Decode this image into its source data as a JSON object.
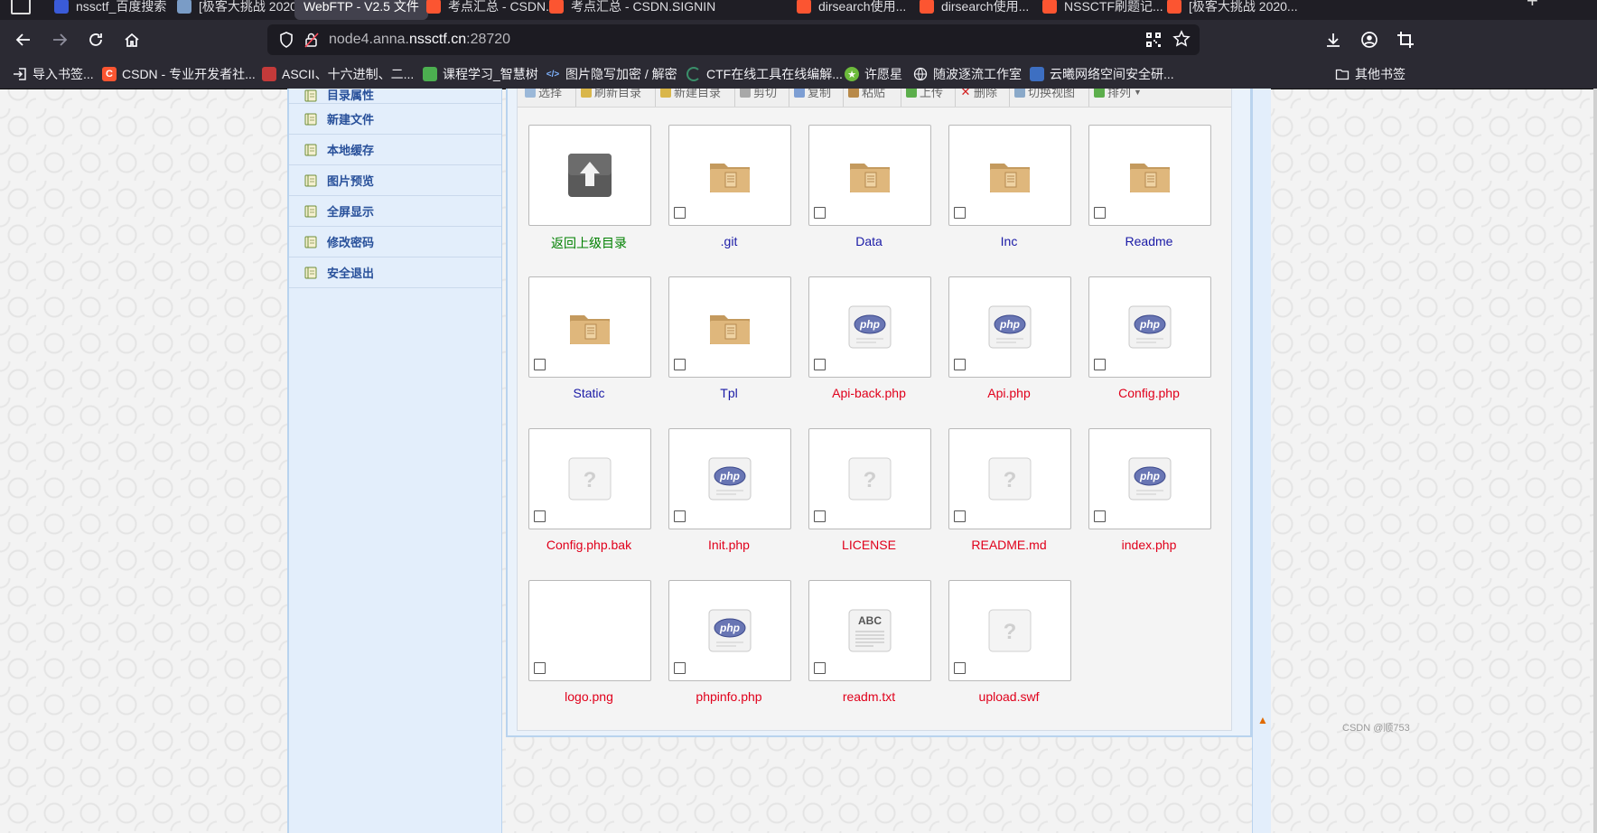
{
  "colors": {
    "chrome_dark": "#1f1e25",
    "chrome": "#2b2a33",
    "link_blue": "#28509a",
    "folder_name": "#1a1aa6",
    "file_name": "#e0001b",
    "parent_name": "#008000"
  },
  "tabs": [
    {
      "label": "nssctf_百度搜索",
      "favicon": "baidu-icon",
      "active": false
    },
    {
      "label": "[极客大挑战 2020...",
      "favicon": "page-icon",
      "active": false
    },
    {
      "label": "WebFTP - V2.5 文件",
      "favicon": "",
      "active": true
    },
    {
      "label": "考点汇总 - CSDN...",
      "favicon": "csdn-icon",
      "active": false
    },
    {
      "label": "考点汇总 - CSDN...",
      "favicon": "csdn-icon",
      "active": false
    },
    {
      "label": "SIGNIN",
      "favicon": "",
      "active": false
    },
    {
      "label": "dirsearch使用...",
      "favicon": "csdn-icon",
      "active": false
    },
    {
      "label": "dirsearch使用...",
      "favicon": "csdn-icon",
      "active": false
    },
    {
      "label": "NSSCTF刷题记...",
      "favicon": "csdn-icon",
      "active": false
    },
    {
      "label": "[极客大挑战 2020...",
      "favicon": "csdn-icon",
      "active": false
    }
  ],
  "url": {
    "host_prefix": "node4.anna.",
    "host_main": "nssctf.cn",
    "port": ":28720"
  },
  "bookmarks": [
    {
      "label": "导入书签...",
      "icon": "import-icon"
    },
    {
      "label": "CSDN - 专业开发者社...",
      "icon": "csdn-icon"
    },
    {
      "label": "ASCII、十六进制、二...",
      "icon": "page-icon"
    },
    {
      "label": "课程学习_智慧树",
      "icon": "zhihuishu-icon"
    },
    {
      "label": "图片隐写加密 / 解密",
      "icon": "code-icon"
    },
    {
      "label": "CTF在线工具在线编解...",
      "icon": "ctf-icon"
    },
    {
      "label": "许愿星",
      "icon": "star-icon"
    },
    {
      "label": "随波逐流工作室",
      "icon": "globe-icon"
    },
    {
      "label": "云曦网络空间安全研...",
      "icon": "page-icon"
    },
    {
      "label": "其他书签",
      "icon": "folder-icon"
    }
  ],
  "sidebar": {
    "items": [
      {
        "label": "目录属性"
      },
      {
        "label": "新建文件"
      },
      {
        "label": "本地缓存"
      },
      {
        "label": "图片预览"
      },
      {
        "label": "全屏显示"
      },
      {
        "label": "修改密码"
      },
      {
        "label": "安全退出"
      }
    ]
  },
  "toolbar": {
    "items": [
      {
        "label": "选择"
      },
      {
        "label": "刷新目录"
      },
      {
        "label": "新建目录"
      },
      {
        "label": "剪切"
      },
      {
        "label": "复制"
      },
      {
        "label": "粘贴"
      },
      {
        "label": "上传"
      },
      {
        "label": "删除"
      },
      {
        "label": "切换视图"
      },
      {
        "label": "排列"
      }
    ]
  },
  "files": [
    {
      "name": "返回上级目录",
      "type": "parent"
    },
    {
      "name": ".git",
      "type": "folder"
    },
    {
      "name": "Data",
      "type": "folder"
    },
    {
      "name": "Inc",
      "type": "folder"
    },
    {
      "name": "Readme",
      "type": "folder"
    },
    {
      "name": "Static",
      "type": "folder"
    },
    {
      "name": "Tpl",
      "type": "folder"
    },
    {
      "name": "Api-back.php",
      "type": "php"
    },
    {
      "name": "Api.php",
      "type": "php"
    },
    {
      "name": "Config.php",
      "type": "php"
    },
    {
      "name": "Config.php.bak",
      "type": "unknown"
    },
    {
      "name": "Init.php",
      "type": "php"
    },
    {
      "name": "LICENSE",
      "type": "unknown"
    },
    {
      "name": "README.md",
      "type": "unknown"
    },
    {
      "name": "index.php",
      "type": "php"
    },
    {
      "name": "logo.png",
      "type": "image"
    },
    {
      "name": "phpinfo.php",
      "type": "php"
    },
    {
      "name": "readm.txt",
      "type": "text"
    },
    {
      "name": "upload.swf",
      "type": "unknown"
    }
  ],
  "labels": {
    "php_badge": "php",
    "unknown_mark": "?",
    "text_badge": "ABC"
  },
  "watermark": "CSDN @顺753"
}
